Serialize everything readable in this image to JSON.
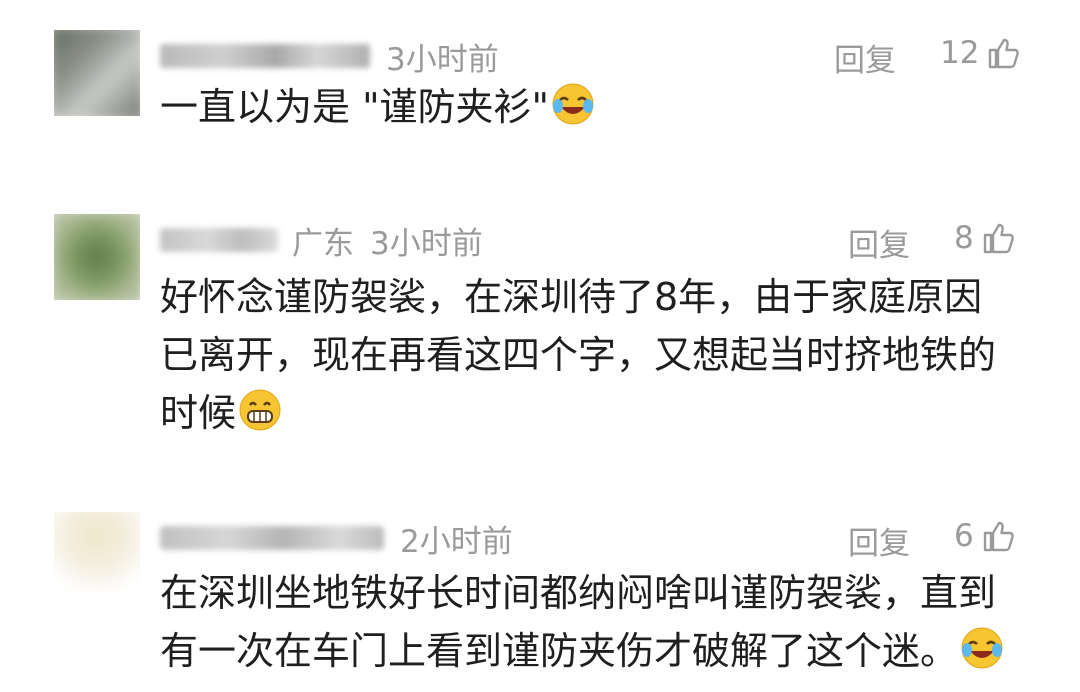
{
  "comments": [
    {
      "location": "",
      "time": "3小时前",
      "reply_label": "回复",
      "like_count": "12",
      "text": "一直以为是 \"谨防夹衫\"",
      "emoji": "laughing-crying-emoji"
    },
    {
      "location": "广东",
      "time": "3小时前",
      "reply_label": "回复",
      "like_count": "8",
      "text": "好怀念谨防袈裟，在深圳待了8年，由于家庭原因已离开，现在再看这四个字，又想起当时挤地铁的时候",
      "emoji": "grinning-emoji"
    },
    {
      "location": "",
      "time": "2小时前",
      "reply_label": "回复",
      "like_count": "6",
      "text": "在深圳坐地铁好长时间都纳闷啥叫谨防袈裟，直到有一次在车门上看到谨防夹伤才破解了这个迷。",
      "emoji": "laughing-crying-emoji"
    }
  ],
  "colors": {
    "meta_text": "#9a9a9a",
    "body_text": "#1f1f1f",
    "background": "#ffffff"
  },
  "icons": {
    "like": "thumbs-up-icon",
    "avatar": "blurred-avatar"
  }
}
